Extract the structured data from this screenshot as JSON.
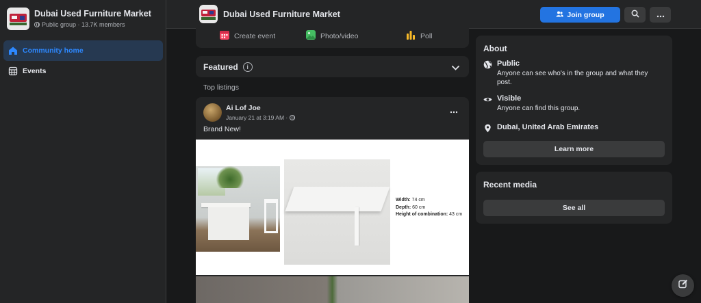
{
  "sidebar": {
    "group_name": "Dubai Used Furniture Market",
    "group_meta": "Public group · 13.7K members",
    "nav": [
      {
        "label": "Community home",
        "icon": "home-icon",
        "active": true
      },
      {
        "label": "Events",
        "icon": "calendar-grid-icon",
        "active": false
      }
    ]
  },
  "topbar": {
    "group_name": "Dubai Used Furniture Market",
    "join_label": "Join group",
    "search_icon": "search-icon",
    "more_icon": "more-icon"
  },
  "composer": {
    "items": [
      {
        "label": "Create event",
        "icon": "calendar-icon",
        "color": "#f3425f"
      },
      {
        "label": "Photo/video",
        "icon": "photo-icon",
        "color": "#45bd62"
      },
      {
        "label": "Poll",
        "icon": "poll-icon",
        "color": "#f7b928"
      }
    ]
  },
  "featured": {
    "title": "Featured",
    "info": "i",
    "subheading": "Top listings"
  },
  "post": {
    "author": "Ai Lof Joe",
    "time": "January 21 at 3:19 AM ·",
    "text": "Brand New!",
    "dims": {
      "width_label": "Width:",
      "width_value": " 74 cm",
      "depth_label": "Depth:",
      "depth_value": " 60 cm",
      "height_label": "Height of combination:",
      "height_value": " 43 cm"
    }
  },
  "about": {
    "title": "About",
    "public_title": "Public",
    "public_desc": "Anyone can see who's in the group and what they post.",
    "visible_title": "Visible",
    "visible_desc": "Anyone can find this group.",
    "location": "Dubai, United Arab Emirates",
    "learn_more": "Learn more"
  },
  "media": {
    "title": "Recent media",
    "see_all": "See all"
  },
  "colors": {
    "accent": "#2374e1",
    "active_nav_bg": "#263951",
    "active_nav_text": "#2d88ff",
    "card_bg": "#242526",
    "page_bg": "#18191a"
  }
}
